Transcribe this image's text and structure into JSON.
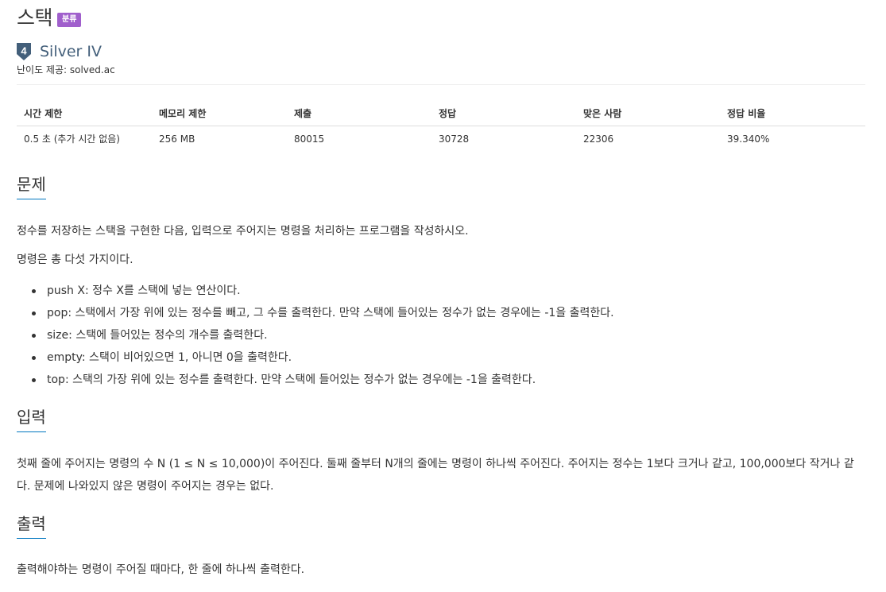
{
  "header": {
    "title": "스택",
    "tag_badge": "분류"
  },
  "tier": {
    "number": "4",
    "label": "Silver IV",
    "difficulty_prefix": "난이도 제공: ",
    "difficulty_link": "solved.ac"
  },
  "info_table": {
    "headers": [
      "시간 제한",
      "메모리 제한",
      "제출",
      "정답",
      "맞은 사람",
      "정답 비율"
    ],
    "values": [
      "0.5 초 (추가 시간 없음)",
      "256 MB",
      "80015",
      "30728",
      "22306",
      "39.340%"
    ]
  },
  "problem": {
    "heading": "문제",
    "para1": "정수를 저장하는 스택을 구현한 다음, 입력으로 주어지는 명령을 처리하는 프로그램을 작성하시오.",
    "para2": "명령은 총 다섯 가지이다.",
    "commands": [
      "push X: 정수 X를 스택에 넣는 연산이다.",
      "pop: 스택에서 가장 위에 있는 정수를 빼고, 그 수를 출력한다. 만약 스택에 들어있는 정수가 없는 경우에는 -1을 출력한다.",
      "size: 스택에 들어있는 정수의 개수를 출력한다.",
      "empty: 스택이 비어있으면 1, 아니면 0을 출력한다.",
      "top: 스택의 가장 위에 있는 정수를 출력한다. 만약 스택에 들어있는 정수가 없는 경우에는 -1을 출력한다."
    ]
  },
  "input": {
    "heading": "입력",
    "text": "첫째 줄에 주어지는 명령의 수 N (1 ≤ N ≤ 10,000)이 주어진다. 둘째 줄부터 N개의 줄에는 명령이 하나씩 주어진다. 주어지는 정수는 1보다 크거나 같고, 100,000보다 작거나 같다. 문제에 나와있지 않은 명령이 주어지는 경우는 없다."
  },
  "output": {
    "heading": "출력",
    "text": "출력해야하는 명령이 주어질 때마다, 한 줄에 하나씩 출력한다."
  },
  "colors": {
    "tag_badge": "#a05fcc",
    "tier_text": "#435f7a",
    "tier_icon": "#435f7a",
    "section_underline": "#0076c0"
  },
  "icons": {
    "tier": "silver-tier-shield-icon"
  }
}
